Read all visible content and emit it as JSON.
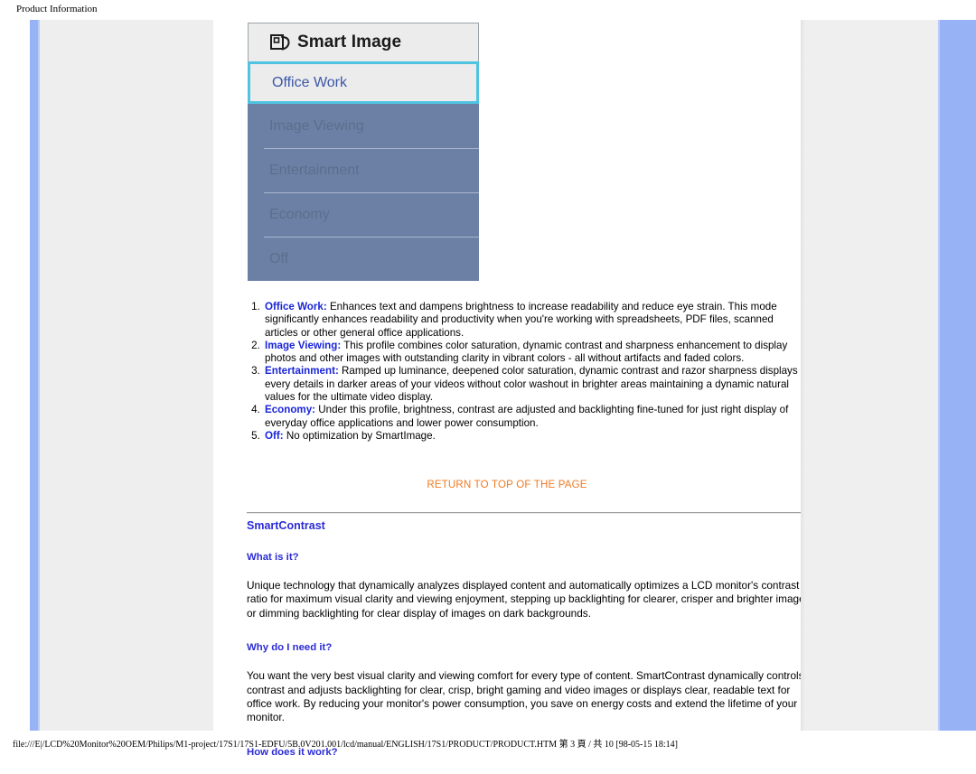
{
  "print": {
    "header": "Product Information",
    "footer": "file:///E|/LCD%20Monitor%20OEM/Philips/M1-project/17S1/17S1-EDFU/5B.0V201.001/lcd/manual/ENGLISH/17S1/PRODUCT/PRODUCT.HTM 第 3 頁 / 共 10 [98-05-15 18:14]"
  },
  "colors": {
    "rail_blue": "#97b3f5",
    "sidebar_gray": "#eeeeee",
    "osd_panel_blue": "#6c80a6",
    "osd_highlight_border": "#4fc3e0",
    "link_orange": "#ef7a22",
    "heading_blue": "#2b2bd6",
    "term_blue": "#1a25d8"
  },
  "osd": {
    "icon": "smart-image-icon",
    "title": "Smart Image",
    "selected_item": "Office Work",
    "items": [
      "Image Viewing",
      "Entertainment",
      "Economy",
      "Off"
    ]
  },
  "feature_list": [
    {
      "term": "Office Work:",
      "text": " Enhances text and dampens brightness to increase readability and reduce eye strain. This mode significantly enhances readability and productivity when you're working with spreadsheets, PDF files, scanned articles or other general office applications."
    },
    {
      "term": "Image Viewing:",
      "text": " This profile combines color saturation, dynamic contrast and sharpness enhancement to display photos and other images with outstanding clarity in vibrant colors - all without artifacts and faded colors."
    },
    {
      "term": "Entertainment:",
      "text": " Ramped up luminance, deepened color saturation, dynamic contrast and razor sharpness displays every details in darker areas of your videos without color washout in brighter areas maintaining a dynamic natural values for the ultimate video display."
    },
    {
      "term": "Economy:",
      "text": " Under this profile, brightness, contrast are adjusted and backlighting fine-tuned for just right display of everyday office applications and lower power consumption."
    },
    {
      "term": "Off:",
      "text": " No optimization by SmartImage."
    }
  ],
  "return_link": "RETURN TO TOP OF THE PAGE",
  "smartcontrast": {
    "title": "SmartContrast",
    "q1": "What is it?",
    "a1": "Unique technology that dynamically analyzes displayed content and automatically optimizes a LCD monitor's contrast ratio for maximum visual clarity and viewing enjoyment, stepping up backlighting for clearer, crisper and brighter images or dimming backlighting for clear display of images on dark backgrounds.",
    "q2": "Why do I need it?",
    "a2": "You want the very best visual clarity and viewing comfort for every type of content. SmartContrast dynamically controls contrast and adjusts backlighting for clear, crisp, bright gaming and video images or displays clear, readable text for office work. By reducing your monitor's power consumption, you save on energy costs and extend the lifetime of your monitor.",
    "q3": "How does it work?"
  }
}
